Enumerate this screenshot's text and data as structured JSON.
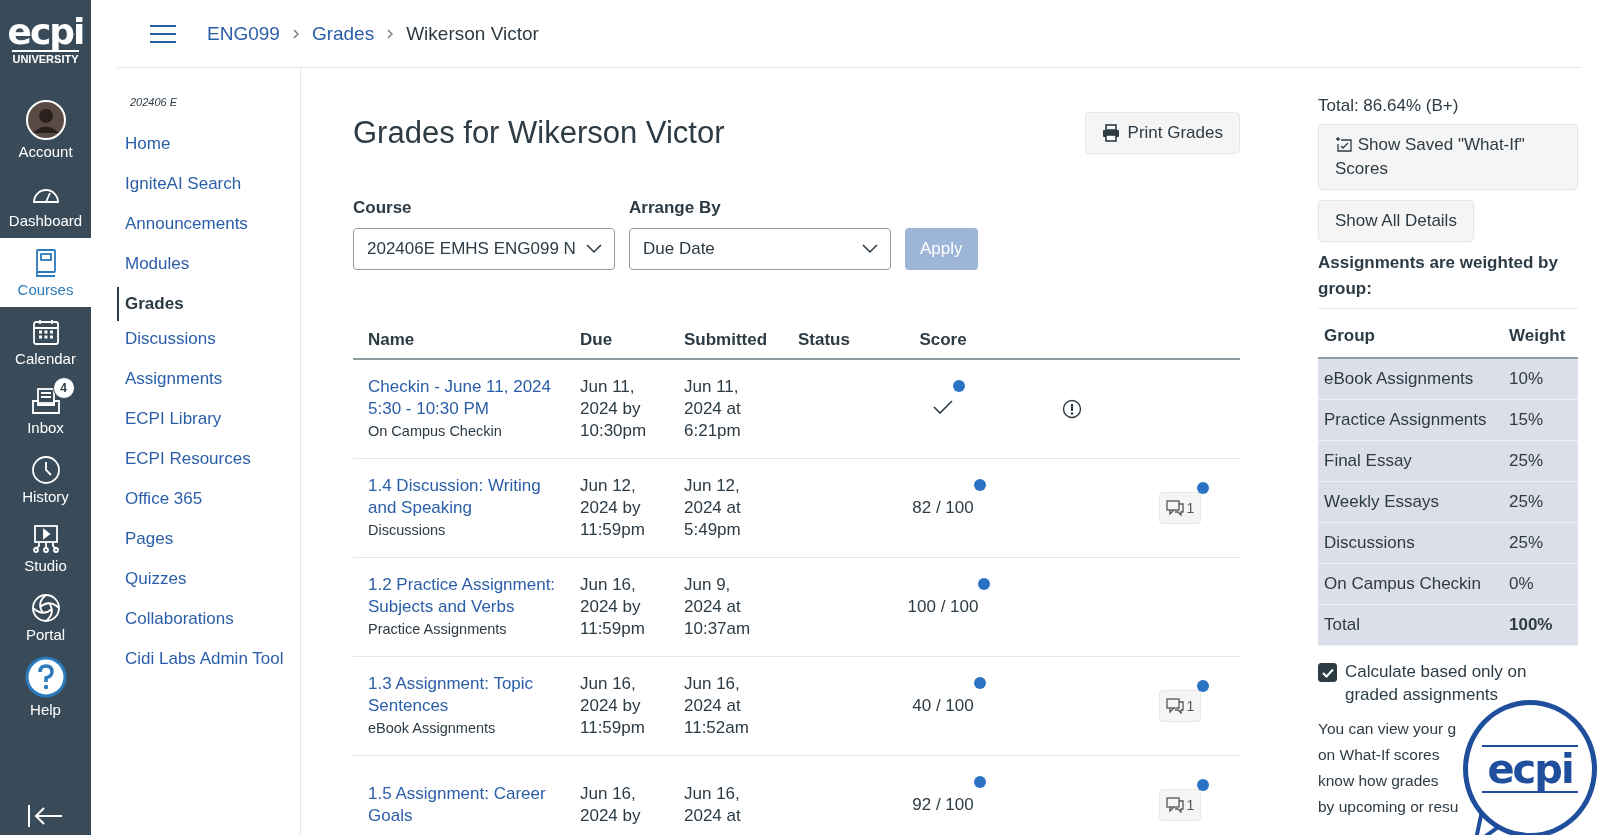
{
  "logo": {
    "word": "ecpi",
    "subtitle": "UNIVERSITY"
  },
  "global_nav": [
    {
      "label": "Account",
      "selected": false
    },
    {
      "label": "Dashboard",
      "selected": false
    },
    {
      "label": "Courses",
      "selected": true
    },
    {
      "label": "Calendar",
      "selected": false
    },
    {
      "label": "Inbox",
      "selected": false,
      "badge": "4"
    },
    {
      "label": "History",
      "selected": false
    },
    {
      "label": "Studio",
      "selected": false
    },
    {
      "label": "Portal",
      "selected": false
    },
    {
      "label": "Help",
      "selected": false
    }
  ],
  "breadcrumbs": [
    "ENG099",
    "Grades",
    "Wikerson Victor"
  ],
  "course_nav": {
    "term": "202406 E",
    "items": [
      {
        "label": "Home",
        "selected": false
      },
      {
        "label": "IgniteAI Search",
        "selected": false
      },
      {
        "label": "Announcements",
        "selected": false
      },
      {
        "label": "Modules",
        "selected": false
      },
      {
        "label": "Grades",
        "selected": true
      },
      {
        "label": "Discussions",
        "selected": false
      },
      {
        "label": "Assignments",
        "selected": false
      },
      {
        "label": "ECPI Library",
        "selected": false
      },
      {
        "label": "ECPI Resources",
        "selected": false
      },
      {
        "label": "Office 365",
        "selected": false
      },
      {
        "label": "Pages",
        "selected": false
      },
      {
        "label": "Quizzes",
        "selected": false
      },
      {
        "label": "Collaborations",
        "selected": false
      },
      {
        "label": "Cidi Labs Admin Tool",
        "selected": false
      }
    ]
  },
  "page_title": "Grades for Wikerson Victor",
  "print_button": "Print Grades",
  "filters": {
    "course_label": "Course",
    "course_value": "202406E EMHS ENG099 N",
    "arrange_label": "Arrange By",
    "arrange_value": "Due Date",
    "apply": "Apply",
    "apply_disabled": true
  },
  "table": {
    "columns": [
      "Name",
      "Due",
      "Submitted",
      "Status",
      "Score"
    ],
    "rows": [
      {
        "name": "Checkin - June 11, 2024 5:30 - 10:30 PM",
        "group": "On Campus Checkin",
        "due": "Jun 11, 2024 by 10:30pm",
        "submitted": "Jun 11, 2024 at 6:21pm",
        "kind": "check",
        "unread": true,
        "flag": true
      },
      {
        "name": "1.4 Discussion: Writing and Speaking",
        "group": "Discussions",
        "due": "Jun 12, 2024 by 11:59pm",
        "submitted": "Jun 12, 2024 at 5:49pm",
        "kind": "text",
        "score": "82 / 100",
        "unread": true,
        "flag": false,
        "comments": "1",
        "comments_unread": true
      },
      {
        "name": "1.2 Practice Assignment: Subjects and Verbs",
        "group": "Practice Assignments",
        "due": "Jun 16, 2024 by 11:59pm",
        "submitted": "Jun 9, 2024 at 10:37am",
        "kind": "text",
        "score": "100 / 100",
        "unread": true,
        "flag": false
      },
      {
        "name": "1.3 Assignment: Topic Sentences",
        "group": "eBook Assignments",
        "due": "Jun 16, 2024 by 11:59pm",
        "submitted": "Jun 16, 2024 at 11:52am",
        "kind": "text",
        "score": "40 / 100",
        "unread": true,
        "flag": false,
        "comments": "1",
        "comments_unread": true
      },
      {
        "name": "1.5 Assignment: Career Goals",
        "due": "Jun 16, 2024 by",
        "submitted": "Jun 16, 2024 at",
        "kind": "text",
        "score": "92 / 100",
        "unread": true,
        "flag": false,
        "comments": "1",
        "comments_unread": true
      }
    ]
  },
  "sidebar": {
    "total": "Total: 86.64% (B+)",
    "what_if_button": "Show Saved \"What-If\" Scores",
    "details_button": "Show All Details",
    "weighted_note": "Assignments are weighted by group:",
    "weights": {
      "columns": [
        "Group",
        "Weight"
      ],
      "rows": [
        {
          "group": "eBook Assignments",
          "weight": "10%"
        },
        {
          "group": "Practice Assignments",
          "weight": "15%"
        },
        {
          "group": "Final Essay",
          "weight": "25%"
        },
        {
          "group": "Weekly Essays",
          "weight": "25%"
        },
        {
          "group": "Discussions",
          "weight": "25%"
        },
        {
          "group": "On Campus Checkin",
          "weight": "0%"
        },
        {
          "group": "Total",
          "weight": "100%",
          "kind": "total"
        }
      ]
    },
    "calc_checkbox": {
      "label": "Calculate based only on graded assignments",
      "checked": true
    },
    "info_lines": [
      "You can view your g",
      "on What-If scores",
      "know how grades",
      "by upcoming or resu"
    ]
  },
  "chat_widget": {
    "logo": "ecpi"
  }
}
